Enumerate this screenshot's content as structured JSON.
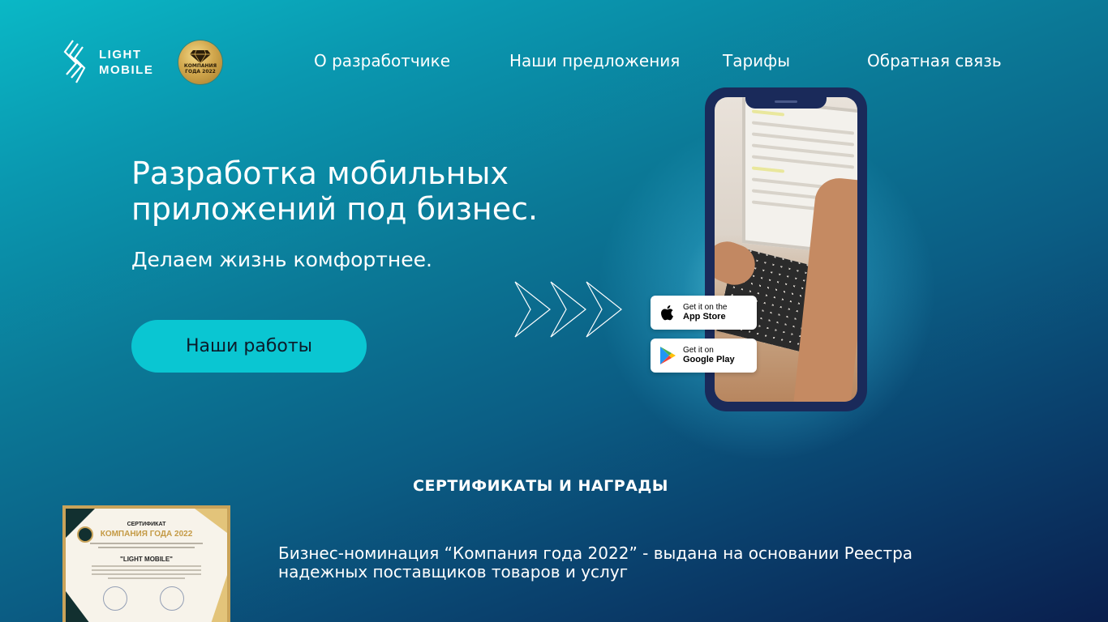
{
  "brand": {
    "name_line1": "LIGHT",
    "name_line2": "MOBILE",
    "award_badge_text": "КОМПАНИЯ ГОДА 2022"
  },
  "nav": {
    "items": [
      {
        "label": "О разработчике"
      },
      {
        "label": "Наши предложения"
      },
      {
        "label": "Тарифы"
      },
      {
        "label": "Обратная связь"
      }
    ]
  },
  "hero": {
    "title_line1": "Разработка мобильных",
    "title_line2": "приложений под бизнес.",
    "subtitle": "Делаем жизнь комфортнее.",
    "cta_label": "Наши работы"
  },
  "store_badges": {
    "app_store": {
      "small": "Get it on the",
      "big": "App Store",
      "icon": "apple-icon"
    },
    "google_play": {
      "small": "Get it on",
      "big": "Google Play",
      "icon": "google-play-icon"
    }
  },
  "certificates": {
    "section_title": "СЕРТИФИКАТЫ И НАГРАДЫ",
    "certificate": {
      "heading": "СЕРТИФИКАТ",
      "title": "КОМПАНИЯ ГОДА 2022",
      "company": "\"LIGHT MOBILE\""
    },
    "description_line1": "Бизнес-номинация “Компания года 2022” - выдана на основании Реестра",
    "description_line2": "надежных поставщиков товаров и услуг"
  },
  "colors": {
    "accent": "#0ac6d2",
    "background_top": "#0ab8c6",
    "background_bottom": "#0a1f4e",
    "phone_frame": "#1a2a5a"
  }
}
